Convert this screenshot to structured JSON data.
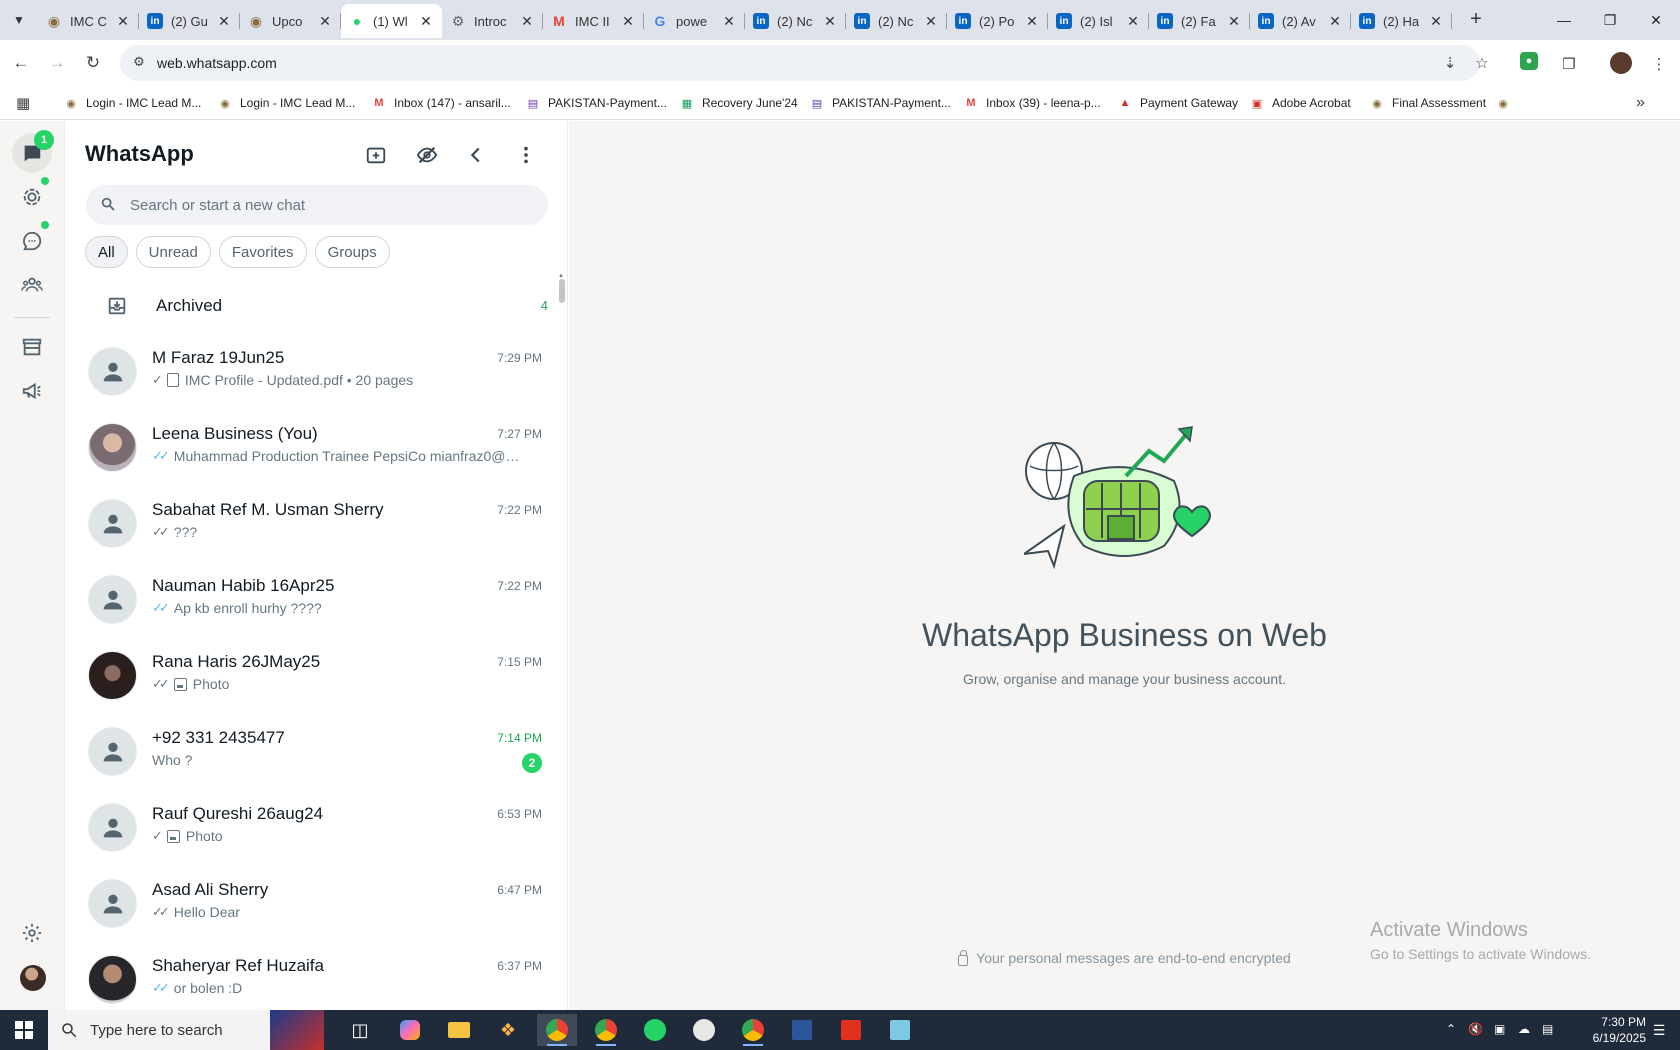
{
  "browser": {
    "tabs": [
      {
        "title": "IMC C",
        "favicon": "imc",
        "color": "#8a6d3b",
        "active": false
      },
      {
        "title": "(2) Gu",
        "favicon": "linkedin",
        "color": "#0a66c2",
        "active": false
      },
      {
        "title": "Upco",
        "favicon": "imc",
        "color": "#8a6d3b",
        "active": false
      },
      {
        "title": "(1) Wl",
        "favicon": "whatsapp",
        "color": "#25d366",
        "active": true
      },
      {
        "title": "Introc",
        "favicon": "chrome-gear",
        "color": "#5f6368",
        "active": false
      },
      {
        "title": "IMC II",
        "favicon": "gmail",
        "color": "#ea4335",
        "active": false
      },
      {
        "title": "powe",
        "favicon": "google",
        "color": "#4285f4",
        "active": false
      },
      {
        "title": "(2) Nc",
        "favicon": "linkedin",
        "color": "#0a66c2",
        "active": false
      },
      {
        "title": "(2) Nc",
        "favicon": "linkedin",
        "color": "#0a66c2",
        "active": false
      },
      {
        "title": "(2) Po",
        "favicon": "linkedin",
        "color": "#0a66c2",
        "active": false
      },
      {
        "title": "(2) Isl",
        "favicon": "linkedin",
        "color": "#0a66c2",
        "active": false
      },
      {
        "title": "(2) Fa",
        "favicon": "linkedin",
        "color": "#0a66c2",
        "active": false
      },
      {
        "title": "(2) Av",
        "favicon": "linkedin",
        "color": "#0a66c2",
        "active": false
      },
      {
        "title": "(2) Ha",
        "favicon": "linkedin",
        "color": "#0a66c2",
        "active": false
      }
    ],
    "url": "web.whatsapp.com",
    "bookmarks": [
      {
        "label": "Login - IMC Lead M...",
        "icon": "imc"
      },
      {
        "label": "Login - IMC Lead M...",
        "icon": "imc"
      },
      {
        "label": "Inbox (147) - ansaril...",
        "icon": "gmail"
      },
      {
        "label": "PAKISTAN-Payment...",
        "icon": "forms"
      },
      {
        "label": "Recovery June'24",
        "icon": "sheets"
      },
      {
        "label": "PAKISTAN-Payment...",
        "icon": "forms"
      },
      {
        "label": "Inbox (39) - leena-p...",
        "icon": "gmail"
      },
      {
        "label": "Payment Gateway",
        "icon": "acrobat-triangle"
      },
      {
        "label": "Adobe Acrobat",
        "icon": "acrobat"
      },
      {
        "label": "Final Assessment",
        "icon": "imc"
      }
    ]
  },
  "whatsapp": {
    "rail_badge": "1",
    "title": "WhatsApp",
    "search_placeholder": "Search or start a new chat",
    "filters": [
      "All",
      "Unread",
      "Favorites",
      "Groups"
    ],
    "archived_label": "Archived",
    "archived_count": "4",
    "chats": [
      {
        "name": "M Faraz 19Jun25",
        "time": "7:29 PM",
        "tick": "single",
        "attach": "doc",
        "preview": "IMC Profile - Updated.pdf • 20 pages",
        "avatar": "default",
        "unread": ""
      },
      {
        "name": "Leena Business (You)",
        "time": "7:27 PM",
        "tick": "blue",
        "attach": "",
        "preview": "Muhammad Production Trainee PepsiCo mianfraz0@g...",
        "avatar": "photo-female",
        "unread": ""
      },
      {
        "name": "Sabahat Ref M. Usman Sherry",
        "time": "7:22 PM",
        "tick": "double",
        "attach": "",
        "preview": "???",
        "avatar": "default",
        "unread": ""
      },
      {
        "name": "Nauman Habib 16Apr25",
        "time": "7:22 PM",
        "tick": "blue",
        "attach": "",
        "preview": "Ap kb enroll hurhy ????",
        "avatar": "default",
        "unread": ""
      },
      {
        "name": "Rana Haris 26JMay25",
        "time": "7:15 PM",
        "tick": "double",
        "attach": "photo",
        "preview": "Photo",
        "avatar": "photo-dark",
        "unread": ""
      },
      {
        "name": "+92 331 2435477",
        "time": "7:14 PM",
        "tick": "",
        "attach": "",
        "preview": "Who ?",
        "avatar": "default",
        "unread": "2"
      },
      {
        "name": "Rauf Qureshi 26aug24",
        "time": "6:53 PM",
        "tick": "single",
        "attach": "photo",
        "preview": "Photo",
        "avatar": "default",
        "unread": ""
      },
      {
        "name": "Asad Ali Sherry",
        "time": "6:47 PM",
        "tick": "double",
        "attach": "",
        "preview": "Hello Dear",
        "avatar": "default",
        "unread": ""
      },
      {
        "name": "Shaheryar Ref Huzaifa",
        "time": "6:37 PM",
        "tick": "blue",
        "attach": "",
        "preview": "or bolen :D",
        "avatar": "photo-male",
        "unread": ""
      }
    ],
    "main_title": "WhatsApp Business on Web",
    "main_subtitle": "Grow, organise and manage your business account.",
    "encryption_note": "Your personal messages are end-to-end encrypted",
    "accent": "#25d366"
  },
  "windows": {
    "activate_title": "Activate Windows",
    "activate_sub": "Go to Settings to activate Windows.",
    "search_label": "Type here to search",
    "time": "7:30 PM",
    "date": "6/19/2025"
  }
}
